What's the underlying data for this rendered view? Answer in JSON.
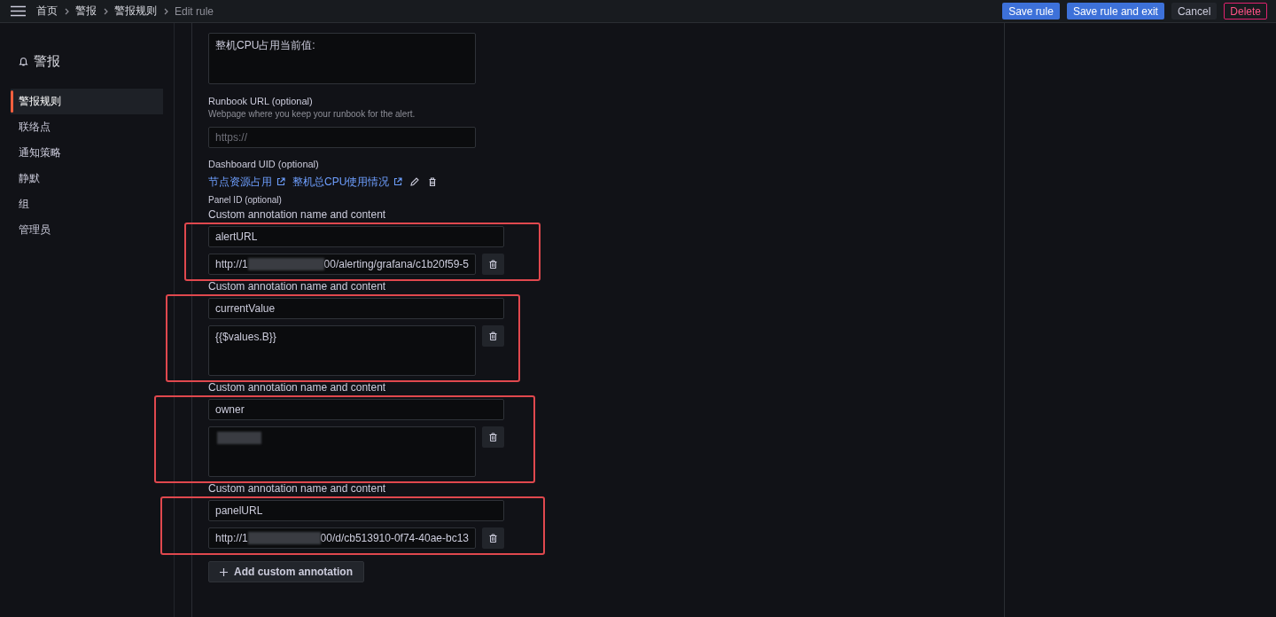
{
  "topbar": {
    "breadcrumbs": [
      {
        "label": "首页",
        "current": false
      },
      {
        "label": "警报",
        "current": false
      },
      {
        "label": "警报规则",
        "current": false
      },
      {
        "label": "Edit rule",
        "current": true
      }
    ],
    "actions": [
      {
        "label": "Save rule",
        "kind": "primary"
      },
      {
        "label": "Save rule and exit",
        "kind": "primary"
      },
      {
        "label": "Cancel",
        "kind": "secondary"
      },
      {
        "label": "Delete",
        "kind": "danger"
      }
    ]
  },
  "sidebar": {
    "title": "警报",
    "items": [
      {
        "label": "警报规则",
        "selected": true
      },
      {
        "label": "联络点",
        "selected": false
      },
      {
        "label": "通知策略",
        "selected": false
      },
      {
        "label": "静默",
        "selected": false
      },
      {
        "label": "组",
        "selected": false
      },
      {
        "label": "管理员",
        "selected": false
      }
    ]
  },
  "form": {
    "description_value": "整机CPU占用当前值:",
    "runbook": {
      "label": "Runbook URL (optional)",
      "description": "Webpage where you keep your runbook for the alert.",
      "placeholder": "https://"
    },
    "dashboard": {
      "label": "Dashboard UID (optional)",
      "links": [
        "节点资源占用",
        "整机总CPU使用情况"
      ]
    },
    "panel_label": "Panel ID (optional)",
    "annotations": [
      {
        "label": "Custom annotation name and content",
        "name": "alertURL",
        "kind": "input",
        "value_start": "http://1",
        "redacted": true,
        "value_end": "00/alerting/grafana/c1b20f59-5",
        "highlighted": true
      },
      {
        "label": "Custom annotation name and content",
        "name": "currentValue",
        "kind": "textarea",
        "value_start": "{{$values.B}}",
        "redacted": false,
        "highlighted": true
      },
      {
        "label": "Custom annotation name and content",
        "name": "owner",
        "kind": "textarea",
        "redacted": true,
        "highlighted": true
      },
      {
        "label": "Custom annotation name and content",
        "name": "panelURL",
        "kind": "input",
        "value_start": "http://1",
        "redacted": true,
        "value_end": "00/d/cb513910-0f74-40ae-bc13",
        "highlighted": true
      }
    ],
    "add_button": "Add custom annotation"
  }
}
